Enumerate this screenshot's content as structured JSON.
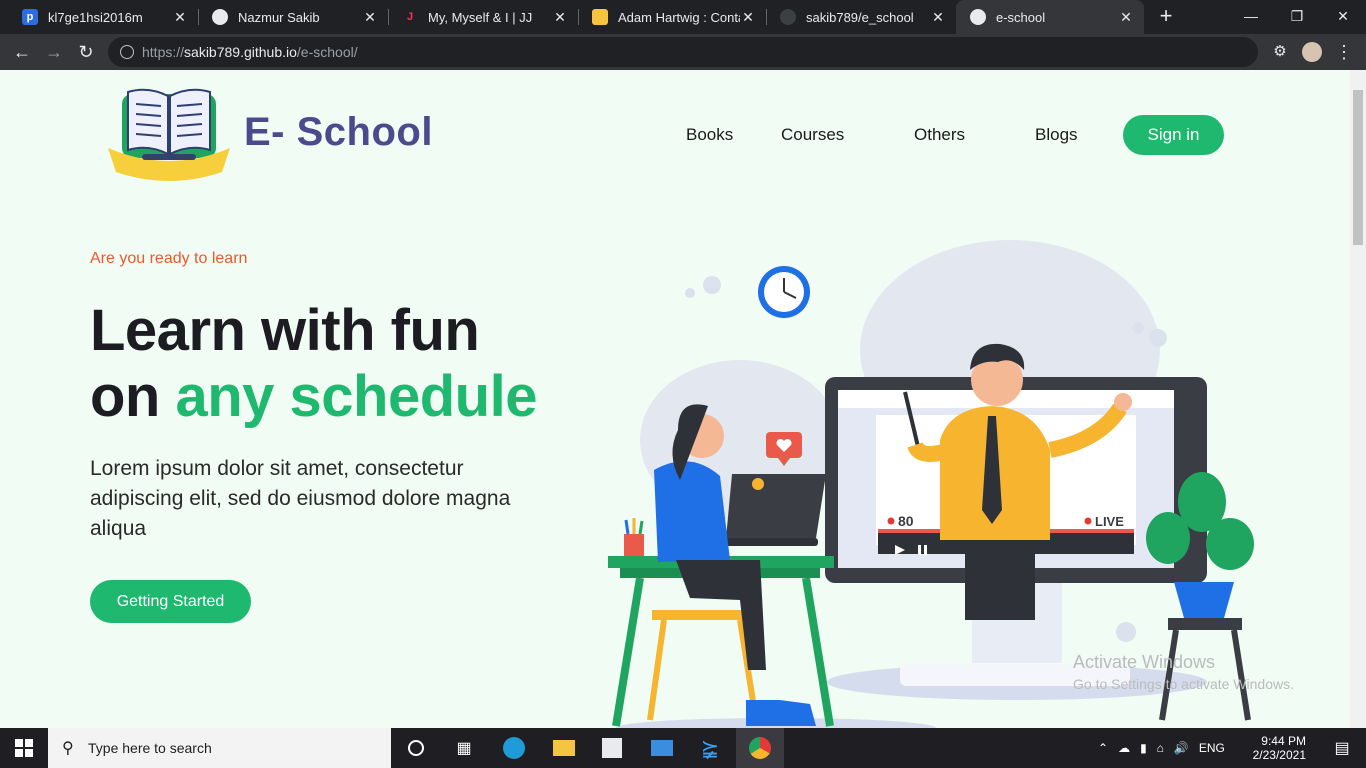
{
  "browser": {
    "tabs": [
      {
        "title": "kl7ge1hsi2016m",
        "favicon": "p-icon"
      },
      {
        "title": "Nazmur Sakib",
        "favicon": "globe-icon"
      },
      {
        "title": "My, Myself & I | JJ",
        "favicon": "j-icon"
      },
      {
        "title": "Adam Hartwig : Contac",
        "favicon": "mountain-icon"
      },
      {
        "title": "sakib789/e_school",
        "favicon": "github-icon"
      },
      {
        "title": "e-school",
        "favicon": "globe-icon"
      }
    ],
    "url_scheme": "https://",
    "url_host": "sakib789.github.io",
    "url_path": "/e-school/"
  },
  "site": {
    "brand": "E- School",
    "nav": [
      "Books",
      "Courses",
      "Others",
      "Blogs"
    ],
    "signin": "Sign in",
    "eyebrow": "Are you ready to learn",
    "headline_line1": "Learn with fun",
    "headline_on": "on ",
    "headline_accent": "any schedule",
    "lead": "Lorem ipsum dolor sit amet, consectetur adipiscing elit, sed do eiusmod dolore magna aliqua",
    "cta": "Getting Started",
    "illustration": {
      "viewers": "80",
      "live": "LIVE"
    }
  },
  "watermark": {
    "title": "Activate Windows",
    "subtitle": "Go to Settings to activate Windows."
  },
  "taskbar": {
    "search_placeholder": "Type here to search",
    "lang": "ENG",
    "time": "9:44 PM",
    "date": "2/23/2021"
  },
  "colors": {
    "accent": "#1fb86f",
    "brand": "#4b4a8c",
    "eyebrow": "#ea5a2b"
  }
}
